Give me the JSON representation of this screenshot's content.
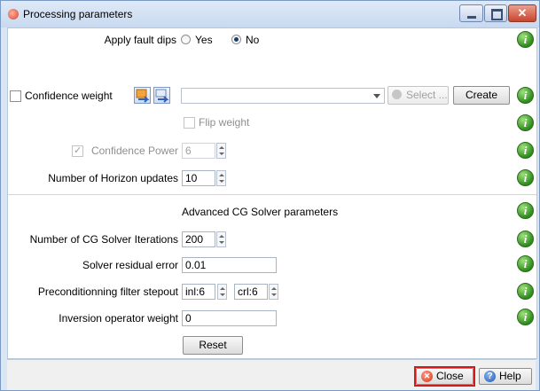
{
  "window": {
    "title": "Processing parameters"
  },
  "fault_dips": {
    "label": "Apply fault dips",
    "yes": "Yes",
    "no": "No",
    "selected": "No"
  },
  "confidence": {
    "checkbox_label": "Confidence weight",
    "combo_value": "",
    "select_label": "Select ...",
    "create_label": "Create",
    "flip_label": "Flip weight",
    "power_label": "Confidence Power",
    "power_value": "6"
  },
  "horizon": {
    "label": "Number of Horizon updates",
    "value": "10"
  },
  "cg": {
    "section_title": "Advanced CG Solver parameters",
    "iterations_label": "Number of CG Solver Iterations",
    "iterations_value": "200",
    "residual_label": "Solver residual error",
    "residual_value": "0.01",
    "stepout_label": "Preconditionning filter stepout",
    "inl_value": "inl:6",
    "crl_value": "crl:6",
    "inversion_label": "Inversion operator weight",
    "inversion_value": "0",
    "reset_label": "Reset"
  },
  "footer": {
    "close_label": "Close",
    "help_label": "Help"
  },
  "info_glyph": "i",
  "colors": {
    "info_green": "#2f8a1e",
    "close_highlight": "#d11a1a",
    "title_bar": "#c8d9ef"
  }
}
